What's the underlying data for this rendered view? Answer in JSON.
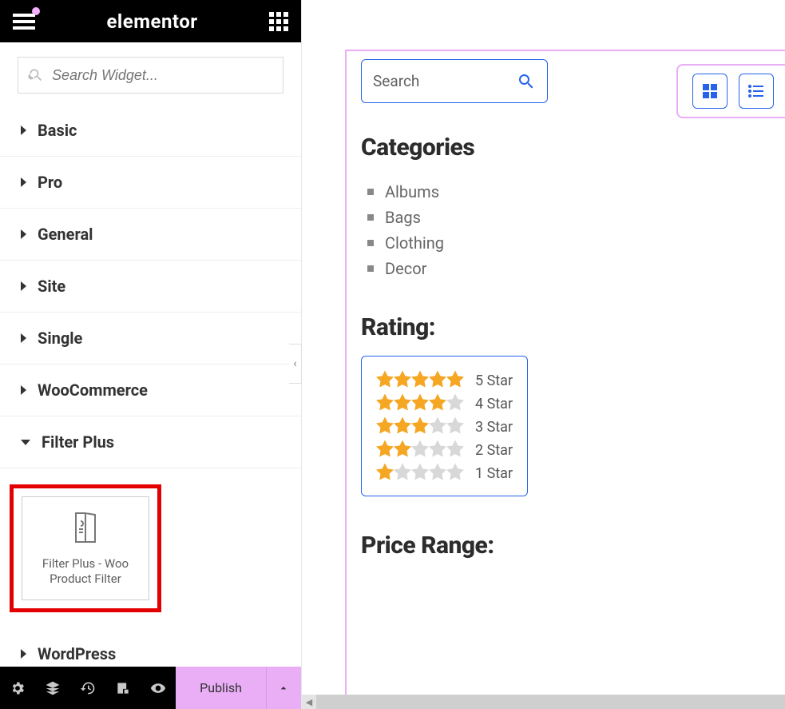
{
  "header": {
    "brand": "elementor"
  },
  "search": {
    "placeholder": "Search Widget..."
  },
  "panelCategories": [
    {
      "label": "Basic",
      "open": false
    },
    {
      "label": "Pro",
      "open": false
    },
    {
      "label": "General",
      "open": false
    },
    {
      "label": "Site",
      "open": false
    },
    {
      "label": "Single",
      "open": false
    },
    {
      "label": "WooCommerce",
      "open": false
    },
    {
      "label": "Filter Plus",
      "open": true
    },
    {
      "label": "WordPress",
      "open": false
    }
  ],
  "widgets": {
    "filterPlus": {
      "title": "Filter Plus - Woo Product Filter"
    }
  },
  "footer": {
    "publish": "Publish"
  },
  "collapseHandle": "‹",
  "preview": {
    "search": {
      "placeholder": "Search"
    },
    "sections": {
      "categoriesTitle": "Categories",
      "ratingTitle": "Rating:",
      "priceTitle": "Price Range:"
    },
    "categories": [
      "Albums",
      "Bags",
      "Clothing",
      "Decor"
    ],
    "ratings": [
      {
        "stars": 5,
        "label": "5 Star"
      },
      {
        "stars": 4,
        "label": "4 Star"
      },
      {
        "stars": 3,
        "label": "3 Star"
      },
      {
        "stars": 2,
        "label": "2 Star"
      },
      {
        "stars": 1,
        "label": "1 Star"
      }
    ],
    "viewModes": {
      "grid": "grid-view",
      "list": "list-view"
    }
  }
}
